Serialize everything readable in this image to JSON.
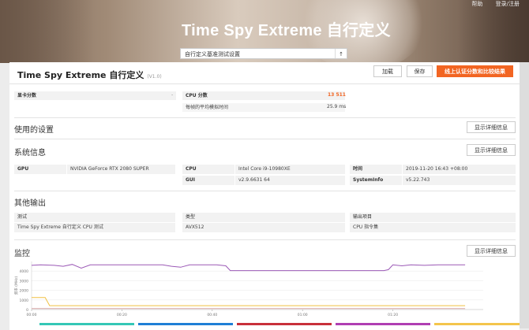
{
  "hero": {
    "title": "Time Spy Extreme 自行定义"
  },
  "top_menu": [
    "帮助",
    "登录/注册"
  ],
  "preset": {
    "value": "自行定义基准测试设置"
  },
  "header": {
    "title": "Time Spy Extreme 自行定义",
    "version": "(V1.0)",
    "load_label": "加载",
    "save_label": "保存",
    "online_label": "线上认证分数和比较结果"
  },
  "scores": {
    "gpu_label": "显卡分数",
    "gpu_value": "-",
    "cpu_label": "CPU 分数",
    "cpu_value": "13 511",
    "sim_label": "每帧的平均模拟时间",
    "sim_value": "25.9 ms"
  },
  "settings": {
    "title": "使用的设置",
    "detail_label": "显示详细信息"
  },
  "sysinfo": {
    "title": "系统信息",
    "detail_label": "显示详细信息",
    "gpu_label": "GPU",
    "gpu_value": "NVIDIA GeForce RTX 2080 SUPER",
    "cpu_label": "CPU",
    "cpu_value": "Intel Core i9-10980XE",
    "gui_label": "GUI",
    "gui_value": "v2.9.6631 64",
    "time_label": "时间",
    "time_value": "2019-11-20 16:43 +08:00",
    "sysinfo_label": "SystemInfo",
    "sysinfo_value": "v5.22.743"
  },
  "other_output": {
    "title": "其他输出",
    "test_label": "测试",
    "test_value": "Time Spy Extreme 自行定义 CPU 测试",
    "type_label": "类型",
    "type_value": "AVX512",
    "out_label": "输出项目",
    "out_value": "CPU 指令集"
  },
  "monitor": {
    "title": "监控",
    "detail_label": "显示详细信息"
  },
  "chart_data": {
    "type": "line",
    "ylabel": "频率 (MHz)",
    "yticks": [
      0,
      1000,
      2000,
      3000,
      4000
    ],
    "ylim": [
      0,
      5000
    ],
    "xlim": [
      0,
      100
    ],
    "xticks": [
      0,
      20,
      40,
      60,
      80
    ],
    "xtick_labels": [
      "00:00",
      "00:20",
      "00:40",
      "01:00",
      "01:20"
    ],
    "series": [
      {
        "color": "#9b59b6",
        "points": [
          [
            0,
            4600
          ],
          [
            2,
            4650
          ],
          [
            5,
            4600
          ],
          [
            7,
            4500
          ],
          [
            9,
            4700
          ],
          [
            11,
            4300
          ],
          [
            13,
            4650
          ],
          [
            20,
            4650
          ],
          [
            23,
            4650
          ],
          [
            26,
            4650
          ],
          [
            29,
            4650
          ],
          [
            31,
            4500
          ],
          [
            33,
            4400
          ],
          [
            35,
            4650
          ],
          [
            38,
            4650
          ],
          [
            41,
            4650
          ],
          [
            43,
            4550
          ],
          [
            44,
            4050
          ],
          [
            50,
            4050
          ],
          [
            60,
            4050
          ],
          [
            70,
            4050
          ],
          [
            78,
            4050
          ],
          [
            79,
            4150
          ],
          [
            80,
            4650
          ],
          [
            82,
            4550
          ],
          [
            84,
            4650
          ],
          [
            87,
            4600
          ],
          [
            90,
            4650
          ],
          [
            93,
            4650
          ],
          [
            96,
            4650
          ]
        ]
      },
      {
        "color": "#f0c040",
        "points": [
          [
            0,
            1250
          ],
          [
            1,
            1250
          ],
          [
            3,
            1250
          ],
          [
            4,
            400
          ],
          [
            5,
            400
          ],
          [
            96,
            400
          ]
        ]
      },
      {
        "color": "#d9a9a9",
        "points": [
          [
            0,
            100
          ],
          [
            96,
            100
          ]
        ]
      }
    ],
    "legend_colors": [
      "#34c7b6",
      "#1f7fd6",
      "#c8303a",
      "#b03fb3",
      "#f4c54c"
    ]
  }
}
